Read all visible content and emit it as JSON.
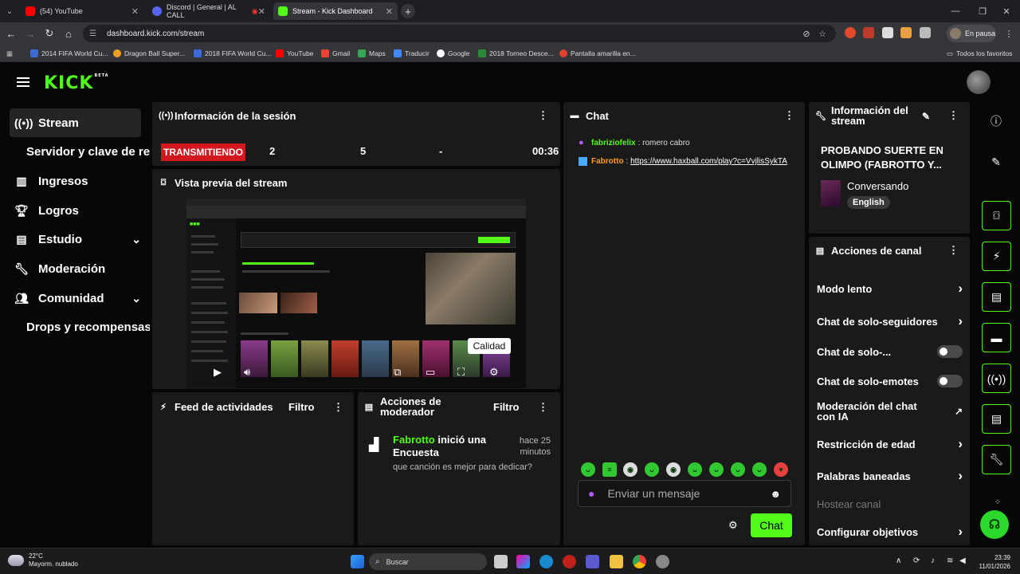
{
  "browser": {
    "tabs": [
      {
        "title": "(54) YouTube",
        "color": "#ff0000"
      },
      {
        "title": "Discord | General | AL CALL",
        "color": "#5865f2"
      },
      {
        "title": "Stream - Kick Dashboard",
        "color": "#53fc18"
      }
    ],
    "url": "dashboard.kick.com/stream",
    "profile_label": "En pausa",
    "bookmarks": [
      {
        "label": "2014 FIFA World Cu...",
        "color": "#3a6bd8"
      },
      {
        "label": "Dragon Ball Super...",
        "color": "#f0a020"
      },
      {
        "label": "2018 FIFA World Cu...",
        "color": "#3a6bd8"
      },
      {
        "label": "YouTube",
        "color": "#ff0000"
      },
      {
        "label": "Gmail",
        "color": "#ea4335"
      },
      {
        "label": "Maps",
        "color": "#34a853"
      },
      {
        "label": "Traducir",
        "color": "#4285f4"
      },
      {
        "label": "Google",
        "color": "#ffffff"
      },
      {
        "label": "2018 Torneo Desce...",
        "color": "#2a8a3a"
      },
      {
        "label": "Pantalla amarilla en...",
        "color": "#e04030"
      }
    ],
    "all_bookmarks": "Todos los favoritos"
  },
  "app": {
    "logo": "KICK",
    "logo_badge": "BETA",
    "sidebar": {
      "items": [
        {
          "label": "Stream",
          "icon": "broadcast-icon"
        },
        {
          "label": "Servidor y clave de retransmisión",
          "icon": ""
        },
        {
          "label": "Ingresos",
          "icon": "bar-chart-icon"
        },
        {
          "label": "Logros",
          "icon": "trophy-icon"
        },
        {
          "label": "Estudio",
          "icon": "studio-icon"
        },
        {
          "label": "Moderación",
          "icon": "wrench-icon"
        },
        {
          "label": "Comunidad",
          "icon": "users-icon"
        },
        {
          "label": "Drops y recompensas",
          "icon": ""
        }
      ]
    },
    "session": {
      "title": "Información de la sesión",
      "live_badge": "TRANSMITIENDO",
      "stats": [
        "2",
        "5",
        "-",
        "00:36"
      ]
    },
    "preview": {
      "title": "Vista previa del stream",
      "quality_tooltip": "Calidad"
    },
    "activity": {
      "title": "Feed de actividades",
      "filter": "Filtro"
    },
    "mod_actions": {
      "title": "Acciones de moderador",
      "filter": "Filtro",
      "entry_user": "Fabrotto",
      "entry_action": "inició una Encuesta",
      "entry_time": "hace 25 minutos",
      "entry_detail": "que canción es mejor para dedicar?"
    },
    "chat": {
      "title": "Chat",
      "messages": [
        {
          "user": "fabriziofelix",
          "text": "romero cabro",
          "user_color": "#53fc18",
          "icon_color": "#b05cff"
        },
        {
          "user": "Fabrotto",
          "text": "https://www.haxball.com/play?c=VvjlisSykTA",
          "user_color": "#ff9a2a",
          "icon_color": "#4aa8ff"
        }
      ],
      "input_placeholder": "Enviar un mensaje",
      "send_label": "Chat"
    },
    "stream_info": {
      "title": "Información del stream",
      "stream_title": "PROBANDO SUERTE EN OLIMPO (FABROTTO Y...",
      "category": "Conversando",
      "language": "English"
    },
    "channel_actions": {
      "title": "Acciones de canal",
      "items": [
        {
          "label": "Modo lento"
        },
        {
          "label": "Chat de solo-seguidores"
        },
        {
          "label": "Chat de solo-..."
        },
        {
          "label": "Chat de solo-emotes"
        },
        {
          "label": "Moderación del chat con IA"
        },
        {
          "label": "Restricción de edad"
        },
        {
          "label": "Palabras baneadas"
        },
        {
          "label": "Hostear canal"
        },
        {
          "label": "Configurar objetivos"
        }
      ]
    }
  },
  "taskbar": {
    "weather_temp": "22°C",
    "weather_desc": "Mayorm. nublado",
    "search": "Buscar",
    "time": "23:39",
    "date": "11/01/2026"
  }
}
